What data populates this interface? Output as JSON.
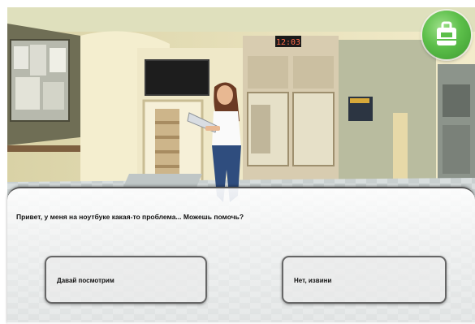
{
  "scene": {
    "clock_text": "12:03",
    "menu_icon": "briefcase-icon",
    "accent_color": "#5cbf4a"
  },
  "dialog": {
    "npc_line": "Привет, у меня на ноутбуке какая-то проблема... Можешь помочь?",
    "answers": [
      {
        "label": "Давай посмотрим"
      },
      {
        "label": "Нет, извини"
      }
    ]
  }
}
